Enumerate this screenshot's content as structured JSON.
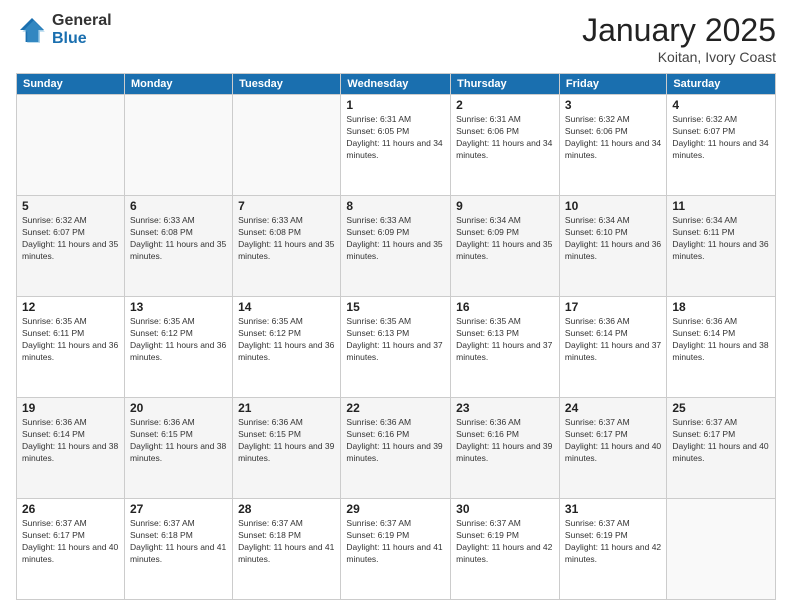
{
  "logo": {
    "general": "General",
    "blue": "Blue"
  },
  "header": {
    "month": "January 2025",
    "location": "Koitan, Ivory Coast"
  },
  "weekdays": [
    "Sunday",
    "Monday",
    "Tuesday",
    "Wednesday",
    "Thursday",
    "Friday",
    "Saturday"
  ],
  "weeks": [
    [
      {
        "day": "",
        "sunrise": "",
        "sunset": "",
        "daylight": ""
      },
      {
        "day": "",
        "sunrise": "",
        "sunset": "",
        "daylight": ""
      },
      {
        "day": "",
        "sunrise": "",
        "sunset": "",
        "daylight": ""
      },
      {
        "day": "1",
        "sunrise": "Sunrise: 6:31 AM",
        "sunset": "Sunset: 6:05 PM",
        "daylight": "Daylight: 11 hours and 34 minutes."
      },
      {
        "day": "2",
        "sunrise": "Sunrise: 6:31 AM",
        "sunset": "Sunset: 6:06 PM",
        "daylight": "Daylight: 11 hours and 34 minutes."
      },
      {
        "day": "3",
        "sunrise": "Sunrise: 6:32 AM",
        "sunset": "Sunset: 6:06 PM",
        "daylight": "Daylight: 11 hours and 34 minutes."
      },
      {
        "day": "4",
        "sunrise": "Sunrise: 6:32 AM",
        "sunset": "Sunset: 6:07 PM",
        "daylight": "Daylight: 11 hours and 34 minutes."
      }
    ],
    [
      {
        "day": "5",
        "sunrise": "Sunrise: 6:32 AM",
        "sunset": "Sunset: 6:07 PM",
        "daylight": "Daylight: 11 hours and 35 minutes."
      },
      {
        "day": "6",
        "sunrise": "Sunrise: 6:33 AM",
        "sunset": "Sunset: 6:08 PM",
        "daylight": "Daylight: 11 hours and 35 minutes."
      },
      {
        "day": "7",
        "sunrise": "Sunrise: 6:33 AM",
        "sunset": "Sunset: 6:08 PM",
        "daylight": "Daylight: 11 hours and 35 minutes."
      },
      {
        "day": "8",
        "sunrise": "Sunrise: 6:33 AM",
        "sunset": "Sunset: 6:09 PM",
        "daylight": "Daylight: 11 hours and 35 minutes."
      },
      {
        "day": "9",
        "sunrise": "Sunrise: 6:34 AM",
        "sunset": "Sunset: 6:09 PM",
        "daylight": "Daylight: 11 hours and 35 minutes."
      },
      {
        "day": "10",
        "sunrise": "Sunrise: 6:34 AM",
        "sunset": "Sunset: 6:10 PM",
        "daylight": "Daylight: 11 hours and 36 minutes."
      },
      {
        "day": "11",
        "sunrise": "Sunrise: 6:34 AM",
        "sunset": "Sunset: 6:11 PM",
        "daylight": "Daylight: 11 hours and 36 minutes."
      }
    ],
    [
      {
        "day": "12",
        "sunrise": "Sunrise: 6:35 AM",
        "sunset": "Sunset: 6:11 PM",
        "daylight": "Daylight: 11 hours and 36 minutes."
      },
      {
        "day": "13",
        "sunrise": "Sunrise: 6:35 AM",
        "sunset": "Sunset: 6:12 PM",
        "daylight": "Daylight: 11 hours and 36 minutes."
      },
      {
        "day": "14",
        "sunrise": "Sunrise: 6:35 AM",
        "sunset": "Sunset: 6:12 PM",
        "daylight": "Daylight: 11 hours and 36 minutes."
      },
      {
        "day": "15",
        "sunrise": "Sunrise: 6:35 AM",
        "sunset": "Sunset: 6:13 PM",
        "daylight": "Daylight: 11 hours and 37 minutes."
      },
      {
        "day": "16",
        "sunrise": "Sunrise: 6:35 AM",
        "sunset": "Sunset: 6:13 PM",
        "daylight": "Daylight: 11 hours and 37 minutes."
      },
      {
        "day": "17",
        "sunrise": "Sunrise: 6:36 AM",
        "sunset": "Sunset: 6:14 PM",
        "daylight": "Daylight: 11 hours and 37 minutes."
      },
      {
        "day": "18",
        "sunrise": "Sunrise: 6:36 AM",
        "sunset": "Sunset: 6:14 PM",
        "daylight": "Daylight: 11 hours and 38 minutes."
      }
    ],
    [
      {
        "day": "19",
        "sunrise": "Sunrise: 6:36 AM",
        "sunset": "Sunset: 6:14 PM",
        "daylight": "Daylight: 11 hours and 38 minutes."
      },
      {
        "day": "20",
        "sunrise": "Sunrise: 6:36 AM",
        "sunset": "Sunset: 6:15 PM",
        "daylight": "Daylight: 11 hours and 38 minutes."
      },
      {
        "day": "21",
        "sunrise": "Sunrise: 6:36 AM",
        "sunset": "Sunset: 6:15 PM",
        "daylight": "Daylight: 11 hours and 39 minutes."
      },
      {
        "day": "22",
        "sunrise": "Sunrise: 6:36 AM",
        "sunset": "Sunset: 6:16 PM",
        "daylight": "Daylight: 11 hours and 39 minutes."
      },
      {
        "day": "23",
        "sunrise": "Sunrise: 6:36 AM",
        "sunset": "Sunset: 6:16 PM",
        "daylight": "Daylight: 11 hours and 39 minutes."
      },
      {
        "day": "24",
        "sunrise": "Sunrise: 6:37 AM",
        "sunset": "Sunset: 6:17 PM",
        "daylight": "Daylight: 11 hours and 40 minutes."
      },
      {
        "day": "25",
        "sunrise": "Sunrise: 6:37 AM",
        "sunset": "Sunset: 6:17 PM",
        "daylight": "Daylight: 11 hours and 40 minutes."
      }
    ],
    [
      {
        "day": "26",
        "sunrise": "Sunrise: 6:37 AM",
        "sunset": "Sunset: 6:17 PM",
        "daylight": "Daylight: 11 hours and 40 minutes."
      },
      {
        "day": "27",
        "sunrise": "Sunrise: 6:37 AM",
        "sunset": "Sunset: 6:18 PM",
        "daylight": "Daylight: 11 hours and 41 minutes."
      },
      {
        "day": "28",
        "sunrise": "Sunrise: 6:37 AM",
        "sunset": "Sunset: 6:18 PM",
        "daylight": "Daylight: 11 hours and 41 minutes."
      },
      {
        "day": "29",
        "sunrise": "Sunrise: 6:37 AM",
        "sunset": "Sunset: 6:19 PM",
        "daylight": "Daylight: 11 hours and 41 minutes."
      },
      {
        "day": "30",
        "sunrise": "Sunrise: 6:37 AM",
        "sunset": "Sunset: 6:19 PM",
        "daylight": "Daylight: 11 hours and 42 minutes."
      },
      {
        "day": "31",
        "sunrise": "Sunrise: 6:37 AM",
        "sunset": "Sunset: 6:19 PM",
        "daylight": "Daylight: 11 hours and 42 minutes."
      },
      {
        "day": "",
        "sunrise": "",
        "sunset": "",
        "daylight": ""
      }
    ]
  ]
}
